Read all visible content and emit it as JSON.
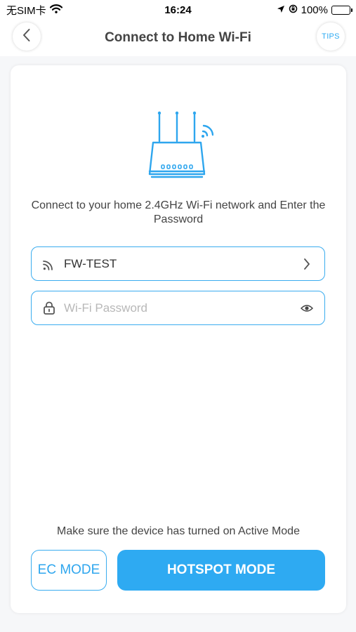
{
  "status_bar": {
    "carrier": "无SIM卡",
    "time": "16:24",
    "battery": "100%"
  },
  "header": {
    "title": "Connect to Home Wi-Fi",
    "tips_label": "TIPS"
  },
  "main": {
    "instruction": "Connect to your home 2.4GHz Wi-Fi network and Enter the Password",
    "ssid": "FW-TEST",
    "password_value": "",
    "password_placeholder": "Wi-Fi Password",
    "note": "Make sure the device has turned on Active Mode",
    "ec_mode_label": "EC MODE",
    "hotspot_mode_label": "HOTSPOT MODE"
  },
  "colors": {
    "accent": "#2eaaf2",
    "border": "#3aacef"
  },
  "icons": [
    "back-chevron-icon",
    "router-icon",
    "wifi-icon",
    "chevron-right-icon",
    "lock-icon",
    "eye-icon"
  ]
}
